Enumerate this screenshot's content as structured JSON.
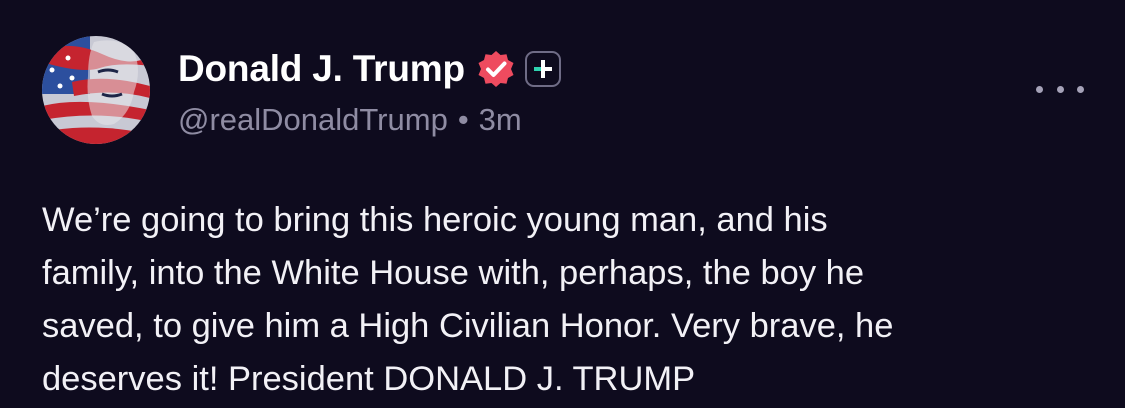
{
  "author": {
    "display_name": "Donald J. Trump",
    "handle": "@realDonaldTrump",
    "separator": "•",
    "timestamp": "3m",
    "avatar_icon": "flag-portrait-avatar",
    "verified_icon": "verified-check-icon",
    "plus_icon": "plus-badge-icon"
  },
  "post": {
    "text": "We’re going to bring this heroic young man, and his\nfamily, into the White House with, perhaps, the boy he\nsaved, to give him a High Civilian Honor. Very brave, he\ndeserves it! President DONALD J. TRUMP"
  },
  "more_icon": "more-options-icon",
  "colors": {
    "background": "#0e0b1e",
    "text_primary": "#ffffff",
    "text_secondary": "#8f8ca3",
    "verified_badge": "#ee4b5f",
    "plus_accent": "#2fd3b0"
  }
}
